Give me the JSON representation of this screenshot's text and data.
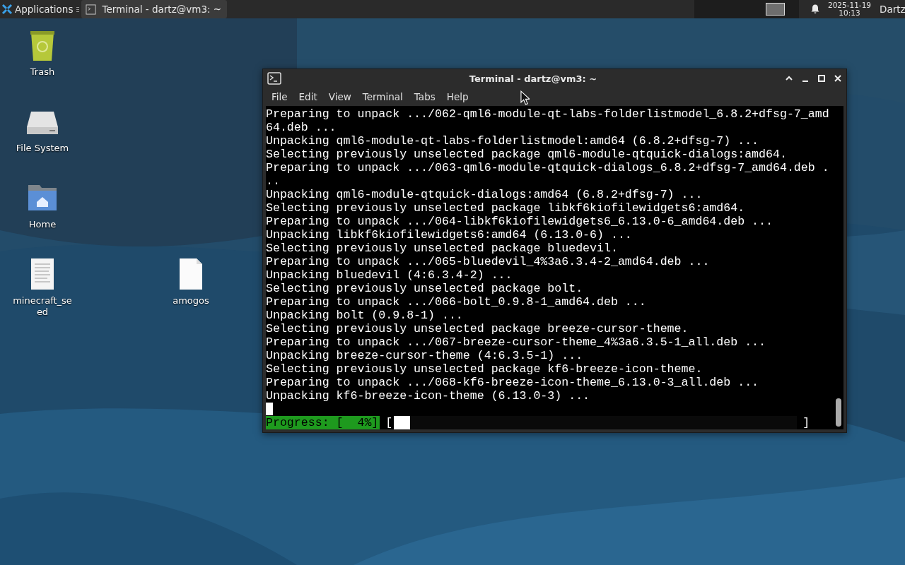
{
  "taskbar": {
    "applications_label": "Applications",
    "tasks": [
      {
        "title": "Terminal - dartz@vm3: ~",
        "selected": true
      }
    ],
    "clock": {
      "date": "2025-11-19",
      "time": "10:13"
    },
    "user": "Dartz"
  },
  "desktop_icons": [
    {
      "label": "Trash",
      "kind": "trash"
    },
    {
      "label": "File System",
      "kind": "drive"
    },
    {
      "label": "Home",
      "kind": "home"
    },
    {
      "label": "minecraft_se\ned",
      "kind": "text-file"
    },
    {
      "label": "amogos",
      "kind": "blank-file"
    }
  ],
  "terminal": {
    "title": "Terminal - dartz@vm3: ~",
    "menu": [
      "File",
      "Edit",
      "View",
      "Terminal",
      "Tabs",
      "Help"
    ],
    "lines": [
      "Preparing to unpack .../062-qml6-module-qt-labs-folderlistmodel_6.8.2+dfsg-7_amd",
      "64.deb ...",
      "Unpacking qml6-module-qt-labs-folderlistmodel:amd64 (6.8.2+dfsg-7) ...",
      "Selecting previously unselected package qml6-module-qtquick-dialogs:amd64.",
      "Preparing to unpack .../063-qml6-module-qtquick-dialogs_6.8.2+dfsg-7_amd64.deb .",
      "..",
      "Unpacking qml6-module-qtquick-dialogs:amd64 (6.8.2+dfsg-7) ...",
      "Selecting previously unselected package libkf6kiofilewidgets6:amd64.",
      "Preparing to unpack .../064-libkf6kiofilewidgets6_6.13.0-6_amd64.deb ...",
      "Unpacking libkf6kiofilewidgets6:amd64 (6.13.0-6) ...",
      "Selecting previously unselected package bluedevil.",
      "Preparing to unpack .../065-bluedevil_4%3a6.3.4-2_amd64.deb ...",
      "Unpacking bluedevil (4:6.3.4-2) ...",
      "Selecting previously unselected package bolt.",
      "Preparing to unpack .../066-bolt_0.9.8-1_amd64.deb ...",
      "Unpacking bolt (0.9.8-1) ...",
      "Selecting previously unselected package breeze-cursor-theme.",
      "Preparing to unpack .../067-breeze-cursor-theme_4%3a6.3.5-1_all.deb ...",
      "Unpacking breeze-cursor-theme (4:6.3.5-1) ...",
      "Selecting previously unselected package kf6-breeze-icon-theme.",
      "Preparing to unpack .../068-kf6-breeze-icon-theme_6.13.0-3_all.deb ...",
      "Unpacking kf6-breeze-icon-theme (6.13.0-3) ..."
    ],
    "progress": {
      "label": "Progress: [  4%]",
      "open": "[",
      "close": "]",
      "level": 0.04
    }
  }
}
